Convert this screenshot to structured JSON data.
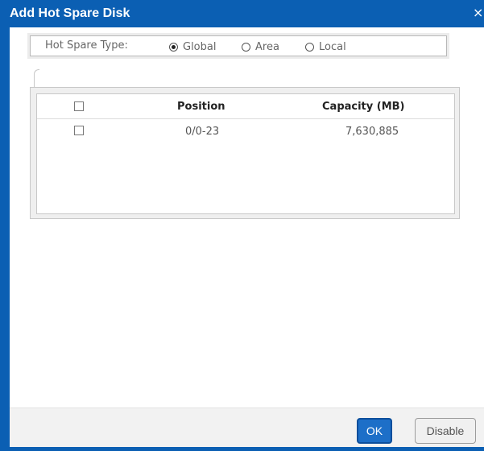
{
  "dialog": {
    "title": "Add Hot Spare Disk",
    "close_icon": "close-icon",
    "close_glyph": "×"
  },
  "hot_spare_type": {
    "label": "Hot Spare Type:",
    "options": [
      {
        "label": "Global",
        "selected": true
      },
      {
        "label": "Area",
        "selected": false
      },
      {
        "label": "Local",
        "selected": false
      }
    ]
  },
  "table": {
    "columns": [
      "Position",
      "Capacity (MB)"
    ],
    "rows": [
      {
        "checked": false,
        "position": "0/0-23",
        "capacity": "7,630,885"
      }
    ]
  },
  "buttons": {
    "ok": "OK",
    "disable": "Disable"
  },
  "colors": {
    "title_bar": "#0b5fb3",
    "ok_button": "#1d6fc8"
  }
}
